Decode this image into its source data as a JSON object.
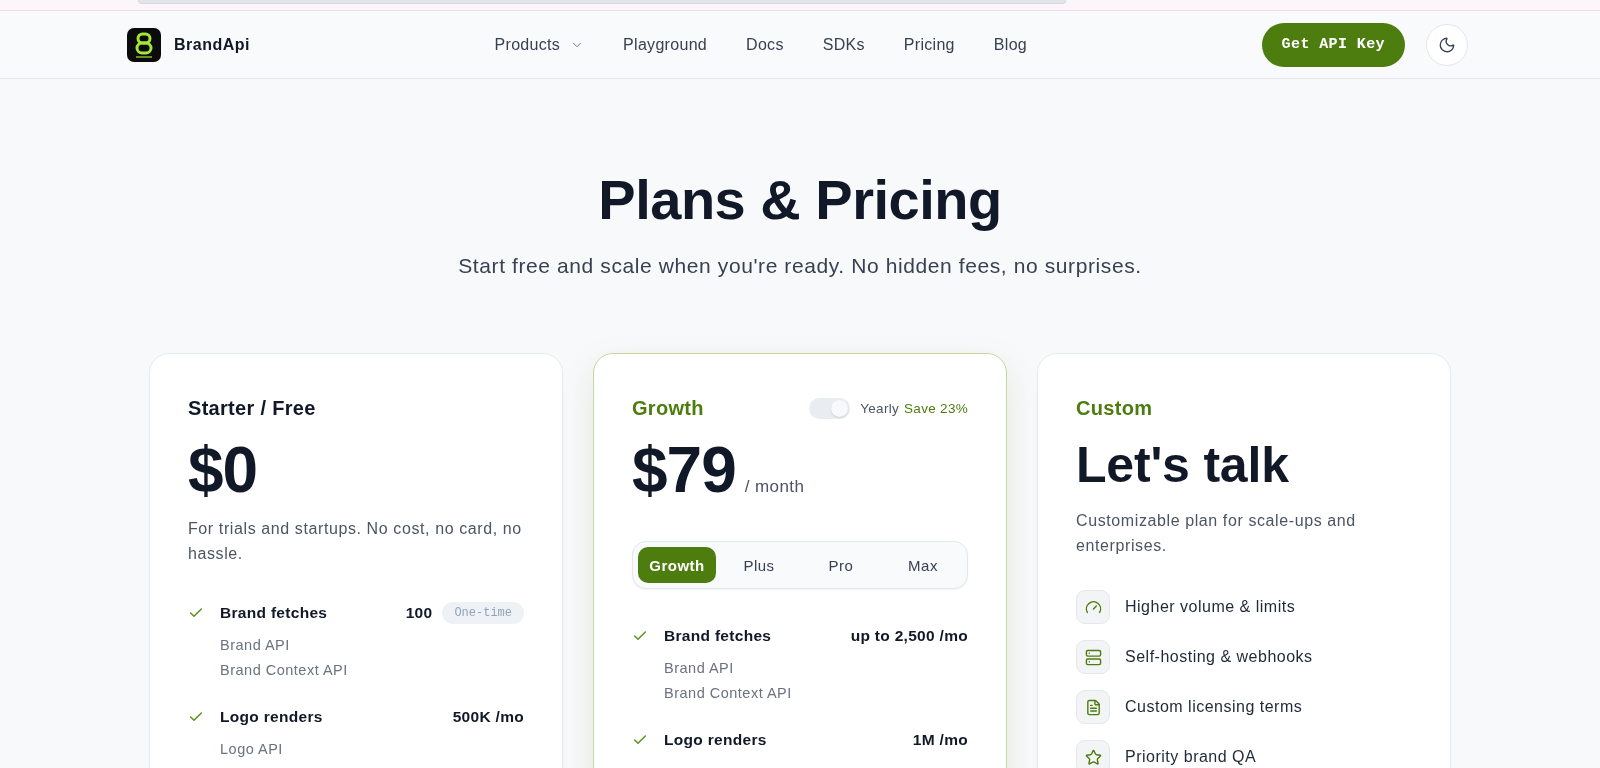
{
  "header": {
    "brand": "BrandApi",
    "nav": [
      {
        "label": "Products",
        "kind": "dropdown"
      },
      {
        "label": "Playground",
        "kind": "link"
      },
      {
        "label": "Docs",
        "kind": "link"
      },
      {
        "label": "SDKs",
        "kind": "link"
      },
      {
        "label": "Pricing",
        "kind": "link"
      },
      {
        "label": "Blog",
        "kind": "link"
      }
    ],
    "cta": "Get API Key"
  },
  "hero": {
    "title": "Plans & Pricing",
    "subtitle": "Start free and scale when you're ready. No hidden fees, no surprises."
  },
  "plans": [
    {
      "kind": "standard",
      "name": "Starter / Free",
      "accent": false,
      "highlighted": false,
      "price": "$0",
      "description": "For trials and startups. No cost, no card, no hassle.",
      "features": [
        {
          "name": "Brand fetches",
          "value": "100",
          "badge": "One-time",
          "items": [
            "Brand API",
            "Brand Context API"
          ]
        },
        {
          "name": "Logo renders",
          "value": "500K /mo",
          "items": [
            "Logo API"
          ]
        }
      ]
    },
    {
      "kind": "standard",
      "name": "Growth",
      "accent": true,
      "highlighted": true,
      "billing_toggle": {
        "on": true,
        "label": "Yearly",
        "note": "Save 23%"
      },
      "price": "$79",
      "period": "/ month",
      "tiers": [
        {
          "label": "Growth",
          "selected": true
        },
        {
          "label": "Plus",
          "selected": false
        },
        {
          "label": "Pro",
          "selected": false
        },
        {
          "label": "Max",
          "selected": false
        }
      ],
      "features": [
        {
          "name": "Brand fetches",
          "value": "up to 2,500 /mo",
          "items": [
            "Brand API",
            "Brand Context API"
          ]
        },
        {
          "name": "Logo renders",
          "value": "1M /mo"
        }
      ]
    },
    {
      "kind": "contact",
      "name": "Custom",
      "accent": true,
      "highlighted": false,
      "headline": "Let's talk",
      "description": "Customizable plan for scale-ups and enterprises.",
      "features": [
        {
          "kind": "volume",
          "label": "Higher volume & limits"
        },
        {
          "kind": "hosting",
          "label": "Self-hosting & webhooks"
        },
        {
          "kind": "licensing",
          "label": "Custom licensing terms"
        },
        {
          "kind": "quality",
          "label": "Priority brand QA"
        }
      ]
    }
  ]
}
